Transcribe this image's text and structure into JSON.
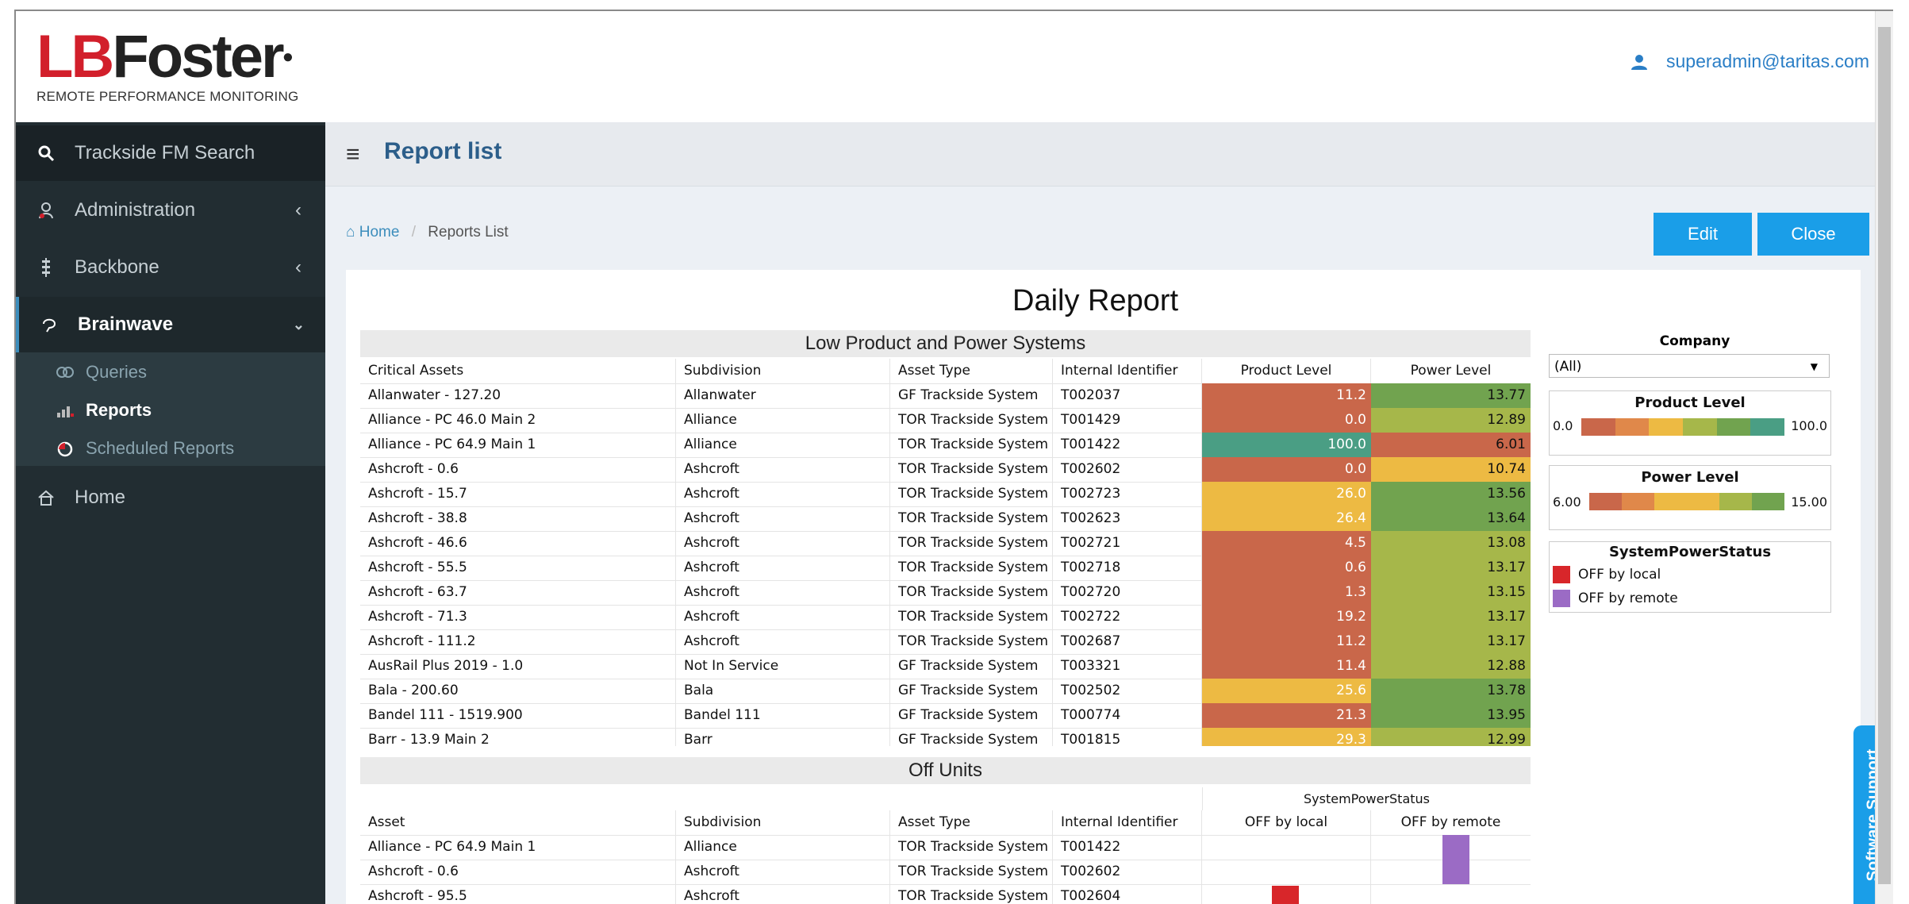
{
  "header": {
    "logo_text": "LBFoster",
    "logo_sub": "REMOTE PERFORMANCE MONITORING",
    "user_email": "superadmin@taritas.com"
  },
  "sidebar": {
    "search": "Trackside FM Search",
    "items": [
      {
        "label": "Administration",
        "icon": "user-admin-icon"
      },
      {
        "label": "Backbone",
        "icon": "backbone-icon"
      },
      {
        "label": "Brainwave",
        "icon": "brainwave-icon"
      }
    ],
    "subitems": [
      {
        "label": "Queries",
        "icon": "queries-icon"
      },
      {
        "label": "Reports",
        "icon": "reports-icon"
      },
      {
        "label": "Scheduled Reports",
        "icon": "scheduled-icon"
      }
    ],
    "home": "Home"
  },
  "page": {
    "title": "Report list",
    "breadcrumb_home": "Home",
    "breadcrumb_current": "Reports List",
    "edit": "Edit",
    "close": "Close",
    "report_title": "Daily Report"
  },
  "low": {
    "title": "Low Product and Power Systems",
    "headers": [
      "Critical Assets",
      "Subdivision",
      "Asset Type",
      "Internal Identifier",
      "Product Level",
      "Power Level"
    ],
    "rows": [
      {
        "asset": "Allanwater - 127.20",
        "sub": "Allanwater",
        "type": "GF Trackside System",
        "id": "T002037",
        "product": "11.2",
        "power": "13.77",
        "pc": "#c9674a",
        "wc": "#71a34f"
      },
      {
        "asset": "Alliance - PC 46.0 Main 2",
        "sub": "Alliance",
        "type": "TOR Trackside System",
        "id": "T001429",
        "product": "0.0",
        "power": "12.89",
        "pc": "#c9674a",
        "wc": "#a6b74a"
      },
      {
        "asset": "Alliance - PC 64.9 Main 1",
        "sub": "Alliance",
        "type": "TOR Trackside System",
        "id": "T001422",
        "product": "100.0",
        "power": "6.01",
        "pc": "#4a9e84",
        "wc": "#c9674a"
      },
      {
        "asset": "Ashcroft - 0.6",
        "sub": "Ashcroft",
        "type": "TOR Trackside System",
        "id": "T002602",
        "product": "0.0",
        "power": "10.74",
        "pc": "#c9674a",
        "wc": "#edba43"
      },
      {
        "asset": "Ashcroft - 15.7",
        "sub": "Ashcroft",
        "type": "TOR Trackside System",
        "id": "T002723",
        "product": "26.0",
        "power": "13.56",
        "pc": "#edba43",
        "wc": "#71a34f"
      },
      {
        "asset": "Ashcroft - 38.8",
        "sub": "Ashcroft",
        "type": "TOR Trackside System",
        "id": "T002623",
        "product": "26.4",
        "power": "13.64",
        "pc": "#edba43",
        "wc": "#71a34f"
      },
      {
        "asset": "Ashcroft - 46.6",
        "sub": "Ashcroft",
        "type": "TOR Trackside System",
        "id": "T002721",
        "product": "4.5",
        "power": "13.08",
        "pc": "#c9674a",
        "wc": "#a6b74a"
      },
      {
        "asset": "Ashcroft - 55.5",
        "sub": "Ashcroft",
        "type": "TOR Trackside System",
        "id": "T002718",
        "product": "0.6",
        "power": "13.17",
        "pc": "#c9674a",
        "wc": "#a6b74a"
      },
      {
        "asset": "Ashcroft - 63.7",
        "sub": "Ashcroft",
        "type": "TOR Trackside System",
        "id": "T002720",
        "product": "1.3",
        "power": "13.15",
        "pc": "#c9674a",
        "wc": "#a6b74a"
      },
      {
        "asset": "Ashcroft - 71.3",
        "sub": "Ashcroft",
        "type": "TOR Trackside System",
        "id": "T002722",
        "product": "19.2",
        "power": "13.17",
        "pc": "#c9674a",
        "wc": "#a6b74a"
      },
      {
        "asset": "Ashcroft - 111.2",
        "sub": "Ashcroft",
        "type": "TOR Trackside System",
        "id": "T002687",
        "product": "11.2",
        "power": "13.17",
        "pc": "#c9674a",
        "wc": "#a6b74a"
      },
      {
        "asset": "AusRail Plus 2019 - 1.0",
        "sub": "Not In Service",
        "type": "GF Trackside System",
        "id": "T003321",
        "product": "11.4",
        "power": "12.88",
        "pc": "#c9674a",
        "wc": "#a6b74a"
      },
      {
        "asset": "Bala - 200.60",
        "sub": "Bala",
        "type": "GF Trackside System",
        "id": "T002502",
        "product": "25.6",
        "power": "13.78",
        "pc": "#edba43",
        "wc": "#71a34f"
      },
      {
        "asset": "Bandel 111 - 1519.900",
        "sub": "Bandel 111",
        "type": "GF Trackside System",
        "id": "T000774",
        "product": "21.3",
        "power": "13.95",
        "pc": "#c9674a",
        "wc": "#71a34f"
      },
      {
        "asset": "Barr - 13.9 Main 2",
        "sub": "Barr",
        "type": "GF Trackside System",
        "id": "T001815",
        "product": "29.3",
        "power": "12.99",
        "pc": "#edba43",
        "wc": "#a6b74a"
      }
    ]
  },
  "off": {
    "title": "Off Units",
    "group_header": "SystemPowerStatus",
    "headers": [
      "Asset",
      "Subdivision",
      "Asset Type",
      "Internal Identifier",
      "OFF by local",
      "OFF by remote"
    ],
    "rows": [
      {
        "asset": "Alliance - PC 64.9 Main 1",
        "sub": "Alliance",
        "type": "TOR Trackside System",
        "id": "T001422",
        "local": false,
        "remote": true
      },
      {
        "asset": "Ashcroft - 0.6",
        "sub": "Ashcroft",
        "type": "TOR Trackside System",
        "id": "T002602",
        "local": false,
        "remote": true
      },
      {
        "asset": "Ashcroft - 95.5",
        "sub": "Ashcroft",
        "type": "TOR Trackside System",
        "id": "T002604",
        "local": true,
        "remote": false
      }
    ]
  },
  "filters": {
    "company_label": "Company",
    "company_value": "(All)",
    "product_label": "Product Level",
    "product_min": "0.0",
    "product_max": "100.0",
    "power_label": "Power Level",
    "power_min": "6.00",
    "power_max": "15.00",
    "status_label": "SystemPowerStatus",
    "status_items": [
      {
        "label": "OFF by local",
        "color": "#d8262a"
      },
      {
        "label": "OFF by remote",
        "color": "#9b6bc5"
      }
    ]
  },
  "support": "Software Support"
}
